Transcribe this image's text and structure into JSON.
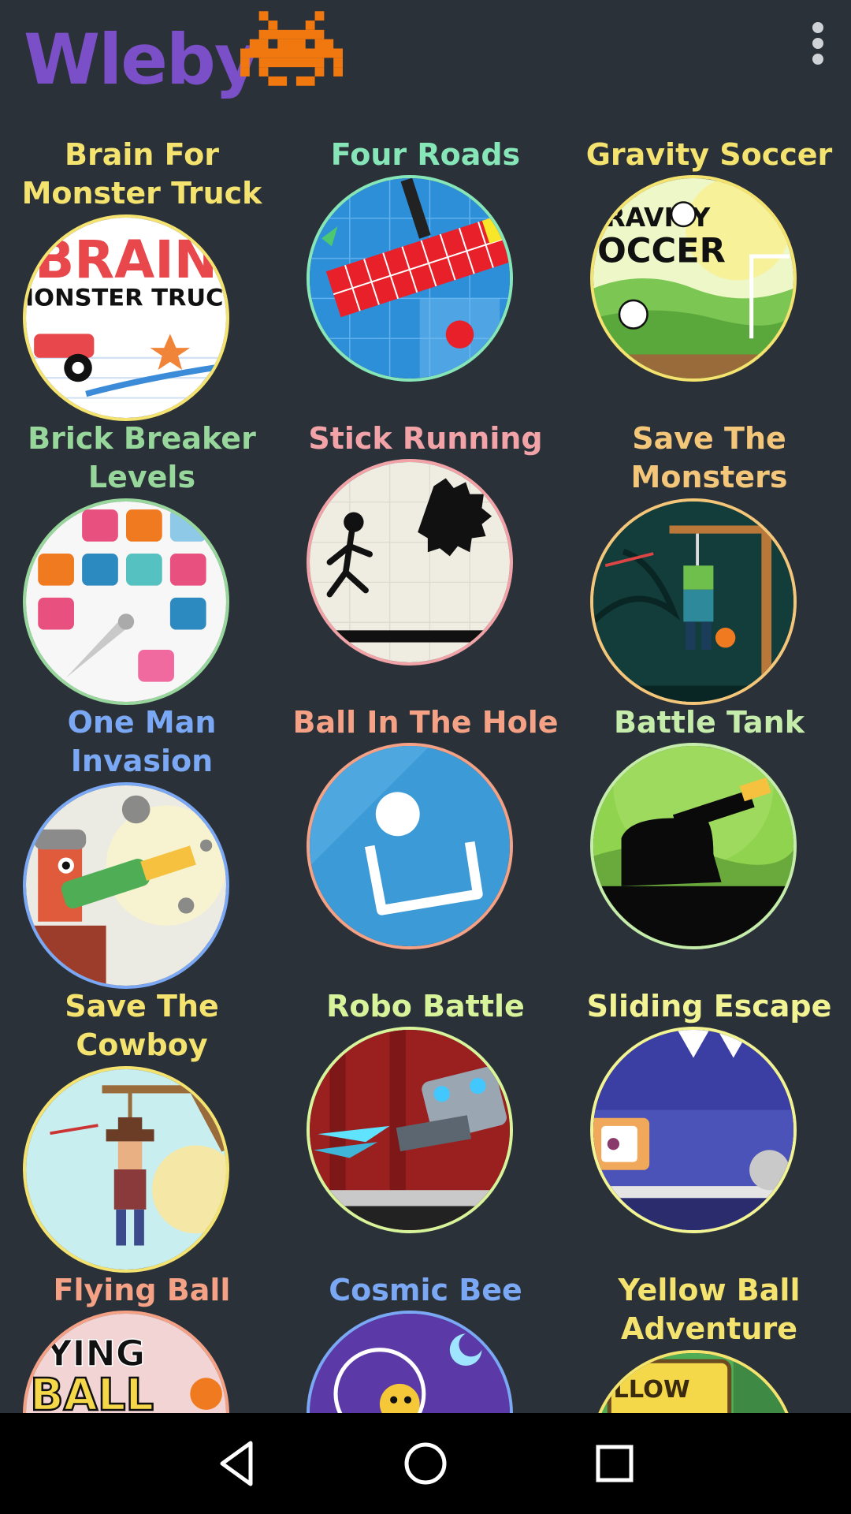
{
  "app": {
    "title": "Wleby",
    "title_color": "#7b4fc8",
    "logo_icon": "space-invader-icon",
    "logo_color": "#f0780f",
    "menu_icon": "more-vertical-icon"
  },
  "games": [
    {
      "title": "Brain For Monster Truck",
      "color": "#f4e36e"
    },
    {
      "title": "Four Roads",
      "color": "#86e6b8"
    },
    {
      "title": "Gravity Soccer",
      "color": "#f4e36e"
    },
    {
      "title": "Brick Breaker Levels",
      "color": "#97d79c"
    },
    {
      "title": "Stick Running",
      "color": "#f1a3a8"
    },
    {
      "title": "Save The Monsters",
      "color": "#f4c67a"
    },
    {
      "title": "One Man Invasion",
      "color": "#7aa8f4"
    },
    {
      "title": "Ball In The Hole",
      "color": "#f4a185"
    },
    {
      "title": "Battle Tank",
      "color": "#c5ecab"
    },
    {
      "title": "Save The Cowboy",
      "color": "#f4e36e"
    },
    {
      "title": "Robo Battle",
      "color": "#d8f49b"
    },
    {
      "title": "Sliding Escape",
      "color": "#f2f392"
    },
    {
      "title": "Flying Ball",
      "color": "#f4a185"
    },
    {
      "title": "Cosmic Bee",
      "color": "#7aa8f4"
    },
    {
      "title": "Yellow Ball Adventure",
      "color": "#f4e36e"
    }
  ],
  "navigation": {
    "back": "back-triangle-icon",
    "home": "home-circle-icon",
    "recents": "recents-square-icon"
  }
}
